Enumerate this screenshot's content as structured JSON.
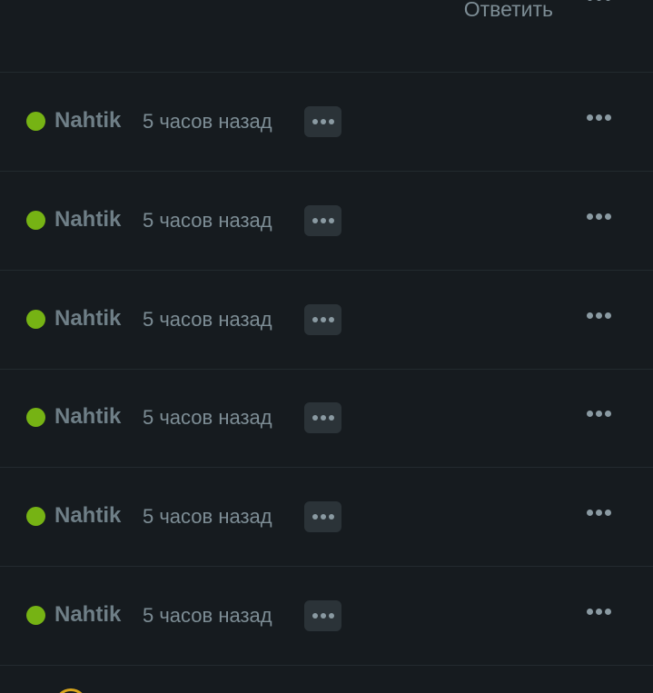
{
  "header": {
    "reply_label": "Ответить"
  },
  "comments": [
    {
      "username": "Nahtik",
      "time": "5 часов назад"
    },
    {
      "username": "Nahtik",
      "time": "5 часов назад"
    },
    {
      "username": "Nahtik",
      "time": "5 часов назад"
    },
    {
      "username": "Nahtik",
      "time": "5 часов назад"
    },
    {
      "username": "Nahtik",
      "time": "5 часов назад"
    },
    {
      "username": "Nahtik",
      "time": "5 часов назад"
    }
  ],
  "colors": {
    "background": "#161b1f",
    "online_status": "#76b314",
    "text_muted": "#7d8d95"
  },
  "icons": {
    "more": "more-horizontal-icon",
    "status": "online-status-icon",
    "avatar": "avatar"
  }
}
